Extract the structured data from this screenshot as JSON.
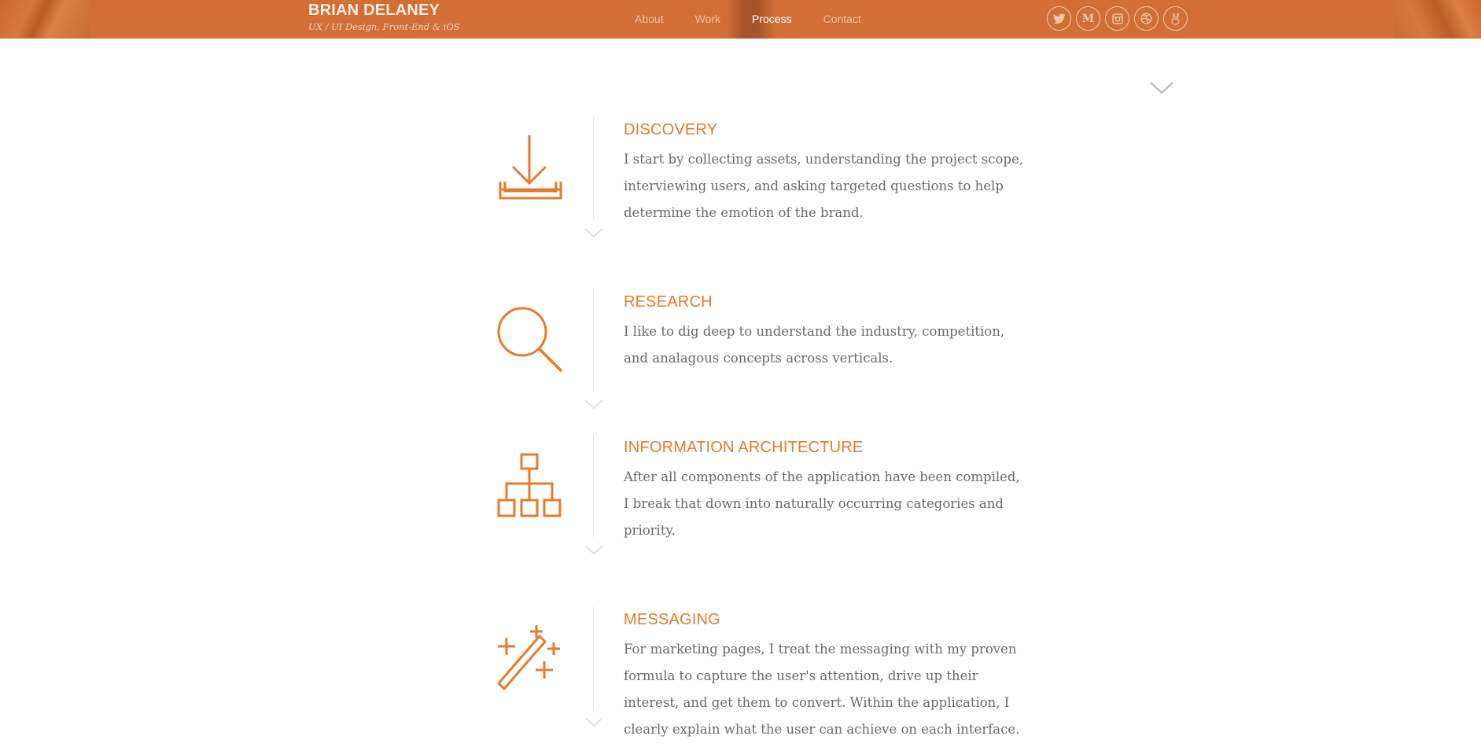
{
  "header": {
    "brand_name": "BRIAN DELANEY",
    "brand_tagline": "UX / UI Design, Front-End & iOS",
    "nav": [
      {
        "label": "About"
      },
      {
        "label": "Work"
      },
      {
        "label": "Process",
        "active": true
      },
      {
        "label": "Contact"
      }
    ],
    "socials": [
      {
        "name": "twitter-icon"
      },
      {
        "name": "medium-icon"
      },
      {
        "name": "instagram-icon"
      },
      {
        "name": "dribbble-icon"
      },
      {
        "name": "peace-icon"
      }
    ],
    "colors": {
      "background": "#d26e36",
      "text": "#fbeee6"
    }
  },
  "process": {
    "accent_color": "#e47c2c",
    "steps": [
      {
        "icon": "download-tray-icon",
        "title": "DISCOVERY",
        "body": "I start by collecting assets, understanding the project scope, interviewing users, and asking targeted questions to help determine the emotion of the brand."
      },
      {
        "icon": "magnifier-icon",
        "title": "RESEARCH",
        "body": "I like to dig deep to understand the industry, competition, and analagous concepts across verticals."
      },
      {
        "icon": "sitemap-icon",
        "title": "INFORMATION ARCHITECTURE",
        "body": "After all components of the application have been compiled, I break that down into naturally occurring categories and priority."
      },
      {
        "icon": "magic-wand-icon",
        "title": "MESSAGING",
        "body": "For marketing pages, I treat the messaging with my proven formula to capture the user's attention, drive up their interest, and get them to convert. Within the application, I clearly explain what the user can achieve on each interface."
      }
    ]
  }
}
